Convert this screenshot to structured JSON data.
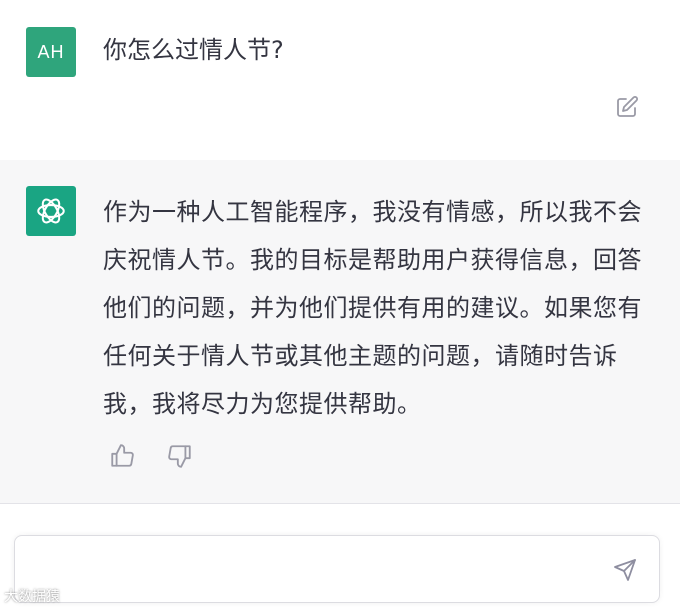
{
  "user_message": {
    "avatar_initials": "AH",
    "text": "你怎么过情人节?",
    "icon": "edit-icon"
  },
  "assistant_message": {
    "avatar_icon": "openai-logo-icon",
    "text": "作为一种人工智能程序，我没有情感，所以我不会庆祝情人节。我的目标是帮助用户获得信息，回答他们的问题，并为他们提供有用的建议。如果您有任何关于情人节或其他主题的问题，请随时告诉我，我将尽力为您提供帮助。",
    "feedback_icons": [
      "thumbs-up-icon",
      "thumbs-down-icon"
    ]
  },
  "composer": {
    "placeholder": "",
    "send_icon": "send-icon"
  },
  "watermark": "大数据猿",
  "colors": {
    "user_avatar": "#2fa57c",
    "bot_avatar": "#1aa583",
    "bot_background": "#f7f7f8",
    "text": "#343541",
    "icon": "#9a9aa6"
  }
}
